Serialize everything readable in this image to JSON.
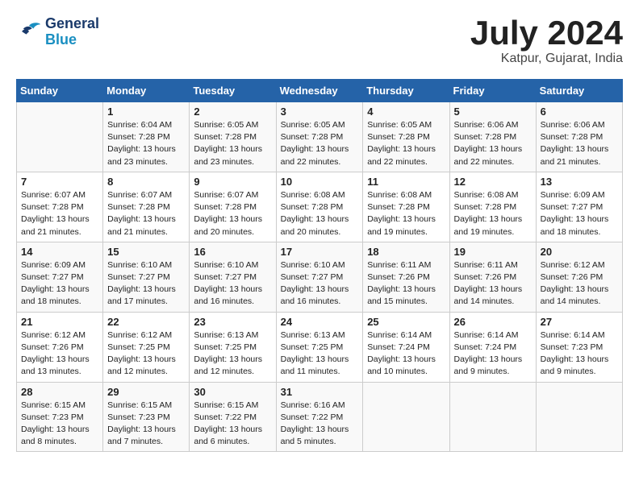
{
  "header": {
    "logo_line1": "General",
    "logo_line2": "Blue",
    "month_title": "July 2024",
    "location": "Katpur, Gujarat, India"
  },
  "days_of_week": [
    "Sunday",
    "Monday",
    "Tuesday",
    "Wednesday",
    "Thursday",
    "Friday",
    "Saturday"
  ],
  "weeks": [
    [
      {
        "day": "",
        "content": ""
      },
      {
        "day": "1",
        "content": "Sunrise: 6:04 AM\nSunset: 7:28 PM\nDaylight: 13 hours\nand 23 minutes."
      },
      {
        "day": "2",
        "content": "Sunrise: 6:05 AM\nSunset: 7:28 PM\nDaylight: 13 hours\nand 23 minutes."
      },
      {
        "day": "3",
        "content": "Sunrise: 6:05 AM\nSunset: 7:28 PM\nDaylight: 13 hours\nand 22 minutes."
      },
      {
        "day": "4",
        "content": "Sunrise: 6:05 AM\nSunset: 7:28 PM\nDaylight: 13 hours\nand 22 minutes."
      },
      {
        "day": "5",
        "content": "Sunrise: 6:06 AM\nSunset: 7:28 PM\nDaylight: 13 hours\nand 22 minutes."
      },
      {
        "day": "6",
        "content": "Sunrise: 6:06 AM\nSunset: 7:28 PM\nDaylight: 13 hours\nand 21 minutes."
      }
    ],
    [
      {
        "day": "7",
        "content": "Sunrise: 6:07 AM\nSunset: 7:28 PM\nDaylight: 13 hours\nand 21 minutes."
      },
      {
        "day": "8",
        "content": "Sunrise: 6:07 AM\nSunset: 7:28 PM\nDaylight: 13 hours\nand 21 minutes."
      },
      {
        "day": "9",
        "content": "Sunrise: 6:07 AM\nSunset: 7:28 PM\nDaylight: 13 hours\nand 20 minutes."
      },
      {
        "day": "10",
        "content": "Sunrise: 6:08 AM\nSunset: 7:28 PM\nDaylight: 13 hours\nand 20 minutes."
      },
      {
        "day": "11",
        "content": "Sunrise: 6:08 AM\nSunset: 7:28 PM\nDaylight: 13 hours\nand 19 minutes."
      },
      {
        "day": "12",
        "content": "Sunrise: 6:08 AM\nSunset: 7:28 PM\nDaylight: 13 hours\nand 19 minutes."
      },
      {
        "day": "13",
        "content": "Sunrise: 6:09 AM\nSunset: 7:27 PM\nDaylight: 13 hours\nand 18 minutes."
      }
    ],
    [
      {
        "day": "14",
        "content": "Sunrise: 6:09 AM\nSunset: 7:27 PM\nDaylight: 13 hours\nand 18 minutes."
      },
      {
        "day": "15",
        "content": "Sunrise: 6:10 AM\nSunset: 7:27 PM\nDaylight: 13 hours\nand 17 minutes."
      },
      {
        "day": "16",
        "content": "Sunrise: 6:10 AM\nSunset: 7:27 PM\nDaylight: 13 hours\nand 16 minutes."
      },
      {
        "day": "17",
        "content": "Sunrise: 6:10 AM\nSunset: 7:27 PM\nDaylight: 13 hours\nand 16 minutes."
      },
      {
        "day": "18",
        "content": "Sunrise: 6:11 AM\nSunset: 7:26 PM\nDaylight: 13 hours\nand 15 minutes."
      },
      {
        "day": "19",
        "content": "Sunrise: 6:11 AM\nSunset: 7:26 PM\nDaylight: 13 hours\nand 14 minutes."
      },
      {
        "day": "20",
        "content": "Sunrise: 6:12 AM\nSunset: 7:26 PM\nDaylight: 13 hours\nand 14 minutes."
      }
    ],
    [
      {
        "day": "21",
        "content": "Sunrise: 6:12 AM\nSunset: 7:26 PM\nDaylight: 13 hours\nand 13 minutes."
      },
      {
        "day": "22",
        "content": "Sunrise: 6:12 AM\nSunset: 7:25 PM\nDaylight: 13 hours\nand 12 minutes."
      },
      {
        "day": "23",
        "content": "Sunrise: 6:13 AM\nSunset: 7:25 PM\nDaylight: 13 hours\nand 12 minutes."
      },
      {
        "day": "24",
        "content": "Sunrise: 6:13 AM\nSunset: 7:25 PM\nDaylight: 13 hours\nand 11 minutes."
      },
      {
        "day": "25",
        "content": "Sunrise: 6:14 AM\nSunset: 7:24 PM\nDaylight: 13 hours\nand 10 minutes."
      },
      {
        "day": "26",
        "content": "Sunrise: 6:14 AM\nSunset: 7:24 PM\nDaylight: 13 hours\nand 9 minutes."
      },
      {
        "day": "27",
        "content": "Sunrise: 6:14 AM\nSunset: 7:23 PM\nDaylight: 13 hours\nand 9 minutes."
      }
    ],
    [
      {
        "day": "28",
        "content": "Sunrise: 6:15 AM\nSunset: 7:23 PM\nDaylight: 13 hours\nand 8 minutes."
      },
      {
        "day": "29",
        "content": "Sunrise: 6:15 AM\nSunset: 7:23 PM\nDaylight: 13 hours\nand 7 minutes."
      },
      {
        "day": "30",
        "content": "Sunrise: 6:15 AM\nSunset: 7:22 PM\nDaylight: 13 hours\nand 6 minutes."
      },
      {
        "day": "31",
        "content": "Sunrise: 6:16 AM\nSunset: 7:22 PM\nDaylight: 13 hours\nand 5 minutes."
      },
      {
        "day": "",
        "content": ""
      },
      {
        "day": "",
        "content": ""
      },
      {
        "day": "",
        "content": ""
      }
    ]
  ]
}
